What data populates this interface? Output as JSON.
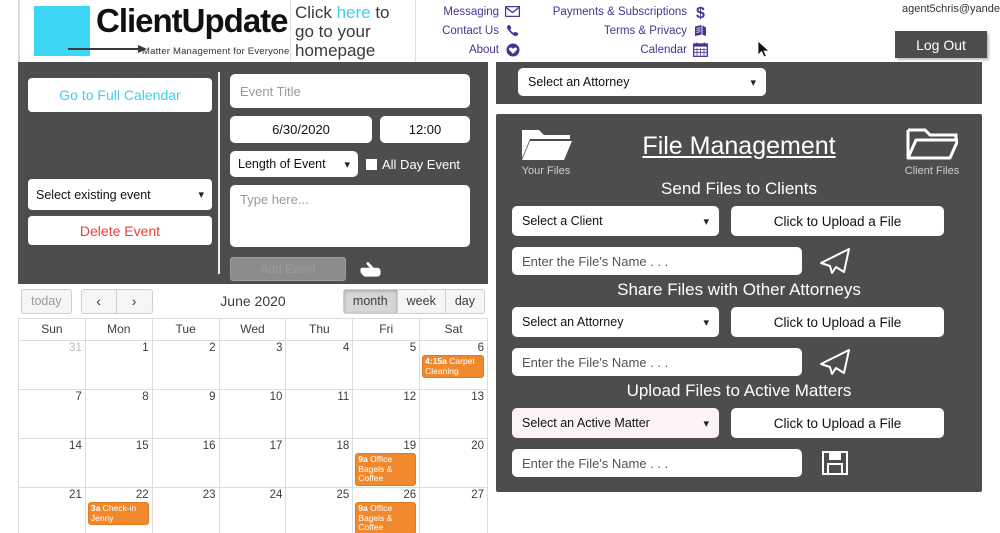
{
  "header": {
    "logo_word": "ClientUpdate",
    "logo_tagline": "Matter Management for Everyone",
    "homepage_text": "Click here to\ngo to your\nhomepage",
    "homepage_link_word": "here",
    "nav_left": [
      {
        "label": "Messaging",
        "icon": "envelope-icon"
      },
      {
        "label": "Contact Us",
        "icon": "phone-icon"
      },
      {
        "label": "About",
        "icon": "heart-badge-icon"
      }
    ],
    "nav_right": [
      {
        "label": "Payments & Subscriptions",
        "icon": "dollar-icon"
      },
      {
        "label": "Terms & Privacy",
        "icon": "books-icon"
      },
      {
        "label": "Calendar",
        "icon": "calendar-icon"
      }
    ],
    "user_email": "agent5chris@yande",
    "logout_label": "Log Out",
    "accent_cyan": "#41cdf0",
    "nav_purple": "#4b3191"
  },
  "event_panel": {
    "full_calendar_label": "Go to Full Calendar",
    "select_existing_label": "Select existing event",
    "delete_label": "Delete Event",
    "title_placeholder": "Event Title",
    "title_value": "",
    "date_value": "6/30/2020",
    "time_value": "12:00",
    "length_label": "Length of Event",
    "all_day_label": "All Day Event",
    "note_placeholder": "Type here...",
    "note_value": "",
    "add_event_label": "Add Event"
  },
  "calendar": {
    "today_label": "today",
    "prev_label": "‹",
    "next_label": "›",
    "title": "June 2020",
    "views": [
      {
        "label": "month",
        "active": true
      },
      {
        "label": "week",
        "active": false
      },
      {
        "label": "day",
        "active": false
      }
    ],
    "weekdays": [
      "Sun",
      "Mon",
      "Tue",
      "Wed",
      "Thu",
      "Fri",
      "Sat"
    ],
    "weeks": [
      [
        {
          "num": "31",
          "other": true,
          "events": []
        },
        {
          "num": "1",
          "other": false,
          "events": []
        },
        {
          "num": "2",
          "other": false,
          "events": []
        },
        {
          "num": "3",
          "other": false,
          "events": []
        },
        {
          "num": "4",
          "other": false,
          "events": []
        },
        {
          "num": "5",
          "other": false,
          "events": []
        },
        {
          "num": "6",
          "other": false,
          "events": [
            {
              "time": "4:15a",
              "title": "Carpet Cleaning"
            }
          ]
        }
      ],
      [
        {
          "num": "7",
          "other": false,
          "events": []
        },
        {
          "num": "8",
          "other": false,
          "events": []
        },
        {
          "num": "9",
          "other": false,
          "events": []
        },
        {
          "num": "10",
          "other": false,
          "events": []
        },
        {
          "num": "11",
          "other": false,
          "events": []
        },
        {
          "num": "12",
          "other": false,
          "events": []
        },
        {
          "num": "13",
          "other": false,
          "events": []
        }
      ],
      [
        {
          "num": "14",
          "other": false,
          "events": []
        },
        {
          "num": "15",
          "other": false,
          "events": []
        },
        {
          "num": "16",
          "other": false,
          "events": []
        },
        {
          "num": "17",
          "other": false,
          "events": []
        },
        {
          "num": "18",
          "other": false,
          "events": []
        },
        {
          "num": "19",
          "other": false,
          "events": [
            {
              "time": "9a",
              "title": "Office Bagels & Coffee"
            }
          ]
        },
        {
          "num": "20",
          "other": false,
          "events": []
        }
      ],
      [
        {
          "num": "21",
          "other": false,
          "events": []
        },
        {
          "num": "22",
          "other": false,
          "events": [
            {
              "time": "3a",
              "title": "Check-in Jenny"
            }
          ]
        },
        {
          "num": "23",
          "other": false,
          "events": []
        },
        {
          "num": "24",
          "other": false,
          "events": []
        },
        {
          "num": "25",
          "other": false,
          "events": []
        },
        {
          "num": "26",
          "other": false,
          "events": [
            {
              "time": "9a",
              "title": "Office Bagels & Coffee"
            }
          ]
        },
        {
          "num": "27",
          "other": false,
          "events": []
        }
      ]
    ],
    "event_color": "#f0892e"
  },
  "attorney_panel": {
    "select_label": "Select an Attorney"
  },
  "file_management": {
    "title": "File Management",
    "your_files_label": "Your Files",
    "client_files_label": "Client Files",
    "sections": [
      {
        "heading": "Send Files to Clients",
        "select_label": "Select a Client",
        "upload_label": "Click to Upload a File",
        "name_placeholder": "Enter the File's Name . . .",
        "name_value": "",
        "action_icon": "paper-plane-icon"
      },
      {
        "heading": "Share Files with Other Attorneys",
        "select_label": "Select an Attorney",
        "upload_label": "Click to Upload a File",
        "name_placeholder": "Enter the File's Name . . .",
        "name_value": "",
        "action_icon": "paper-plane-icon"
      },
      {
        "heading": "Upload Files to Active Matters",
        "select_label": "Select an Active Matter",
        "upload_label": "Click to Upload a File",
        "name_placeholder": "Enter the File's Name . . .",
        "name_value": "",
        "action_icon": "save-disk-icon"
      }
    ]
  },
  "panel_bg": "#4d4d4d"
}
